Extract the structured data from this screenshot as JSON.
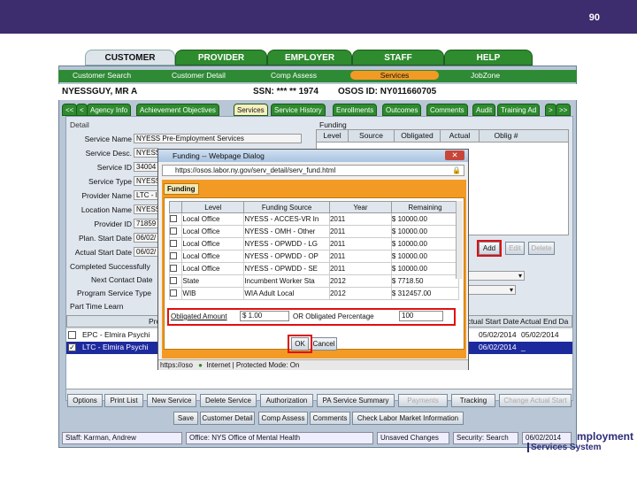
{
  "page_number": "90",
  "top_tabs": [
    "CUSTOMER",
    "PROVIDER",
    "EMPLOYER",
    "STAFF",
    "HELP"
  ],
  "sub_nav": [
    "Customer Search",
    "Customer Detail",
    "Comp Assess",
    "Services",
    "JobZone"
  ],
  "header": {
    "name": "NYESSGUY, MR  A",
    "ssn": "SSN: *** ** 1974",
    "osos": "OSOS ID: NY011660705"
  },
  "tabs": [
    "<<",
    "<",
    "Agency Info",
    "Achievement Objectives",
    "Services",
    "Service History",
    "Enrollments",
    "Outcomes",
    "Comments",
    "Audit",
    "Training Ad",
    ">",
    ">>"
  ],
  "detail": {
    "title": "Detail",
    "fields": [
      {
        "label": "Service Name",
        "value": "NYESS Pre-Employment Services"
      },
      {
        "label": "Service Desc.",
        "value": "NYESS"
      },
      {
        "label": "Service ID",
        "value": "34004"
      },
      {
        "label": "Service Type",
        "value": "NYESS"
      },
      {
        "label": "Provider Name",
        "value": "LTC - I"
      },
      {
        "label": "Location Name",
        "value": "NYESS"
      },
      {
        "label": "Provider ID",
        "value": "71859"
      },
      {
        "label": "Plan. Start Date",
        "value": "06/02/"
      },
      {
        "label": "Actual Start Date",
        "value": "06/02/"
      }
    ],
    "extra_labels": [
      "Completed Successfully",
      "Next Contact Date",
      "Program Service Type",
      "Part Time Learn"
    ]
  },
  "funding": {
    "title": "Funding",
    "headers": [
      "Level",
      "Source",
      "Obligated",
      "Actual",
      "Oblig #"
    ]
  },
  "side_buttons": [
    "Add",
    "Edit",
    "Delete"
  ],
  "lower_list": {
    "col_headers": [
      "Pro",
      "ctual Start Date",
      "Actual End Da"
    ],
    "rows": [
      {
        "name": "EPC - Elmira Psychi",
        "start": "05/02/2014",
        "end": "05/02/2014",
        "checked": false
      },
      {
        "name": "LTC - Elmira Psychi",
        "start": "06/02/2014",
        "end": "_",
        "checked": true
      }
    ]
  },
  "dialog": {
    "title": "Funding -- Webpage Dialog",
    "url": "https://osos.labor.ny.gov/serv_detail/serv_fund.html",
    "inner_tab": "Funding",
    "headers": [
      "Level",
      "Funding Source",
      "Year",
      "Remaining"
    ],
    "rows": [
      [
        "Local Office",
        "NYESS - ACCES-VR In",
        "2011",
        "$ 10000.00"
      ],
      [
        "Local Office",
        "NYESS - OMH - Other",
        "2011",
        "$ 10000.00"
      ],
      [
        "Local Office",
        "NYESS - OPWDD - LG",
        "2011",
        "$ 10000.00"
      ],
      [
        "Local Office",
        "NYESS - OPWDD - OP",
        "2011",
        "$ 10000.00"
      ],
      [
        "Local Office",
        "NYESS - OPWDD - SE",
        "2011",
        "$ 10000.00"
      ],
      [
        "State",
        "Incumbent Worker Sta",
        "2012",
        "$ 7718.50"
      ],
      [
        "WIB",
        "WIA Adult Local",
        "2012",
        "$ 312457.00"
      ]
    ],
    "obligated_label": "Obligated Amount",
    "obligated_value": "$ 1.00",
    "percent_label": "OR Obligated Percentage",
    "percent_value": "100",
    "ok": "OK",
    "cancel": "Cancel",
    "status_url": "https://oso",
    "zone": "Internet | Protected Mode: On"
  },
  "action_row1": [
    "Options",
    "Print List",
    "New Service",
    "Delete Service",
    "Authorization",
    "PA Service Summary",
    "Payments",
    "Tracking",
    "Change Actual Start"
  ],
  "action_row2": [
    "Save",
    "Customer Detail",
    "Comp Assess",
    "Comments",
    "Check Labor Market Information"
  ],
  "status_bar": [
    "Staff: Karman, Andrew",
    "Office: NYS Office of Mental Health",
    "Unsaved Changes",
    "Security: Search",
    "06/02/2014"
  ],
  "logo_text": [
    "mployment",
    "Services System"
  ],
  "colors": {
    "topbar": "#3d2d6e",
    "green": "#2e8b2e",
    "orange": "#f39a24",
    "highlight": "#e01010"
  }
}
